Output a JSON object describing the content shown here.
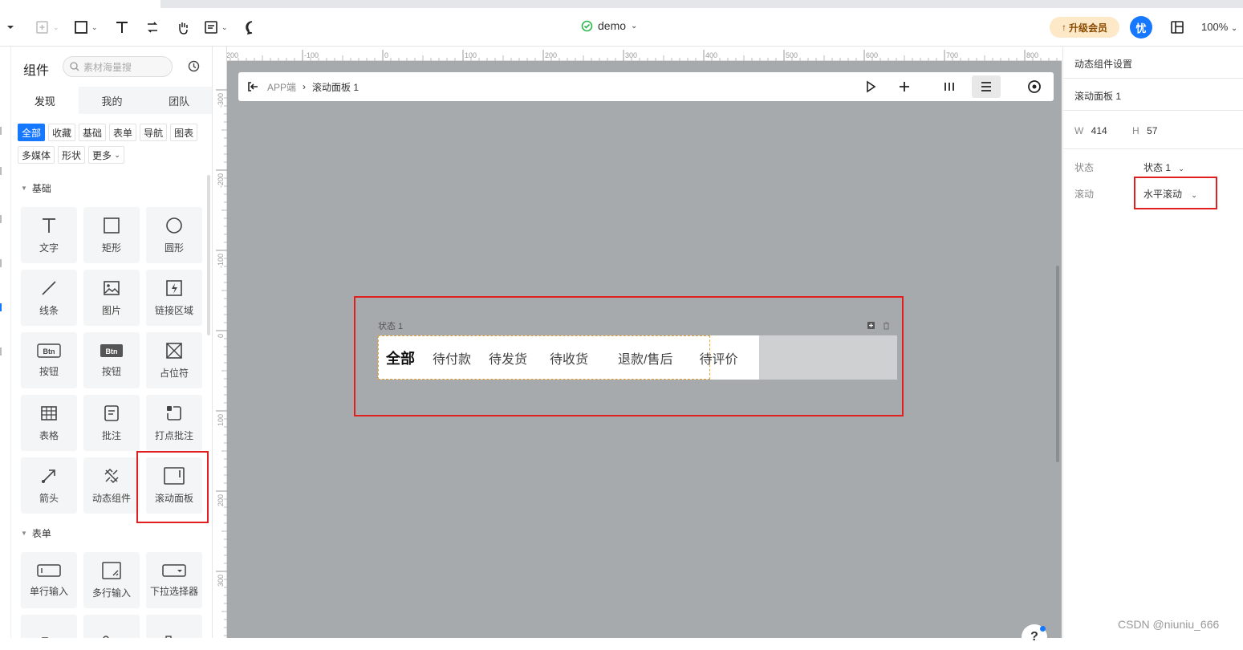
{
  "toolbar": {
    "doc_title": "demo",
    "upgrade_label": "升级会员",
    "avatar_text": "忧",
    "zoom": "100%"
  },
  "components_panel": {
    "title": "组件",
    "search_placeholder": "素材海量搜",
    "tabs": [
      "发现",
      "我的",
      "团队"
    ],
    "categories": [
      "全部",
      "收藏",
      "基础",
      "表单",
      "导航",
      "图表",
      "多媒体",
      "形状",
      "更多"
    ],
    "section_basic": "基础",
    "basic_items": [
      "文字",
      "矩形",
      "圆形",
      "线条",
      "图片",
      "链接区域",
      "按钮",
      "按钮",
      "占位符",
      "表格",
      "批注",
      "打点批注",
      "箭头",
      "动态组件",
      "滚动面板"
    ],
    "btn_icon_text": "Btn",
    "section_form": "表单",
    "form_items": [
      "单行输入",
      "多行输入",
      "下拉选择器"
    ]
  },
  "rulers": {
    "top": [
      "-200",
      "-100",
      "0",
      "100",
      "200",
      "300",
      "400",
      "500",
      "600",
      "700",
      "800"
    ],
    "left": [
      "-300",
      "-200",
      "-100",
      "0",
      "100",
      "200",
      "300"
    ]
  },
  "canvas": {
    "breadcrumb_root": "APP端",
    "breadcrumb_current": "滚动面板 1",
    "state_label": "状态 1",
    "tabs": [
      "全部",
      "待付款",
      "待发货",
      "待收货",
      "退款/售后",
      "待评价"
    ]
  },
  "right_panel": {
    "title": "动态组件设置",
    "component_name": "滚动面板 1",
    "w_label": "W",
    "w_value": "414",
    "h_label": "H",
    "h_value": "57",
    "state_key": "状态",
    "state_value": "状态 1",
    "scroll_key": "滚动",
    "scroll_value": "水平滚动"
  },
  "watermark": "CSDN @niuniu_666",
  "colors": {
    "accent": "#1677ff",
    "highlight": "#e02020",
    "canvas_bg": "#a7aaad"
  }
}
